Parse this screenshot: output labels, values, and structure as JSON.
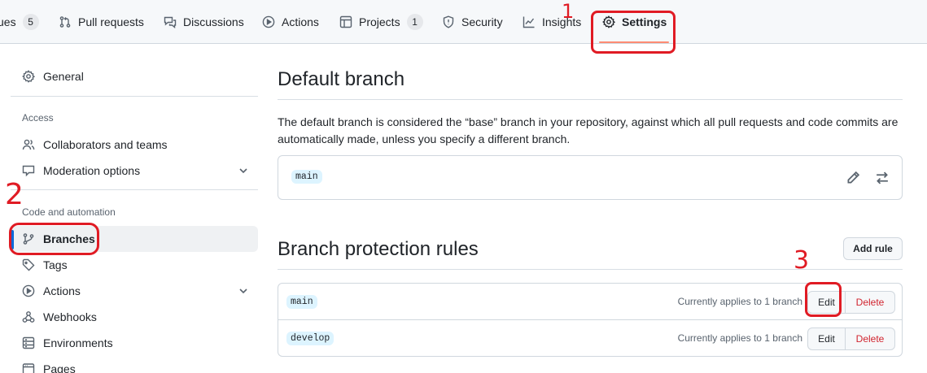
{
  "repo_nav": {
    "tabs": [
      {
        "label": "ues",
        "counter": "5"
      },
      {
        "label": "Pull requests"
      },
      {
        "label": "Discussions"
      },
      {
        "label": "Actions"
      },
      {
        "label": "Projects",
        "counter": "1"
      },
      {
        "label": "Security"
      },
      {
        "label": "Insights"
      },
      {
        "label": "Settings"
      }
    ]
  },
  "sidebar": {
    "general": "General",
    "access_heading": "Access",
    "collaborators": "Collaborators and teams",
    "moderation": "Moderation options",
    "code_heading": "Code and automation",
    "branches": "Branches",
    "tags": "Tags",
    "actions": "Actions",
    "webhooks": "Webhooks",
    "environments": "Environments",
    "pages": "Pages"
  },
  "default_branch": {
    "title": "Default branch",
    "description": "The default branch is considered the “base” branch in your repository, against which all pull requests and code commits are automatically made, unless you specify a different branch.",
    "branch": "main"
  },
  "protection": {
    "title": "Branch protection rules",
    "add_rule": "Add rule",
    "rules": [
      {
        "branch": "main",
        "applies": "Currently applies to 1 branch",
        "edit": "Edit",
        "delete": "Delete"
      },
      {
        "branch": "develop",
        "applies": "Currently applies to 1 branch",
        "edit": "Edit",
        "delete": "Delete"
      }
    ]
  },
  "annotations": {
    "step1": "1",
    "step2": "2",
    "step3": "3",
    "color": "#e01b24"
  },
  "colors": {
    "accent": "#0969da",
    "tab_underline": "#fd8c73",
    "danger": "#d1242f",
    "branch_chip": "#ddf4ff"
  }
}
